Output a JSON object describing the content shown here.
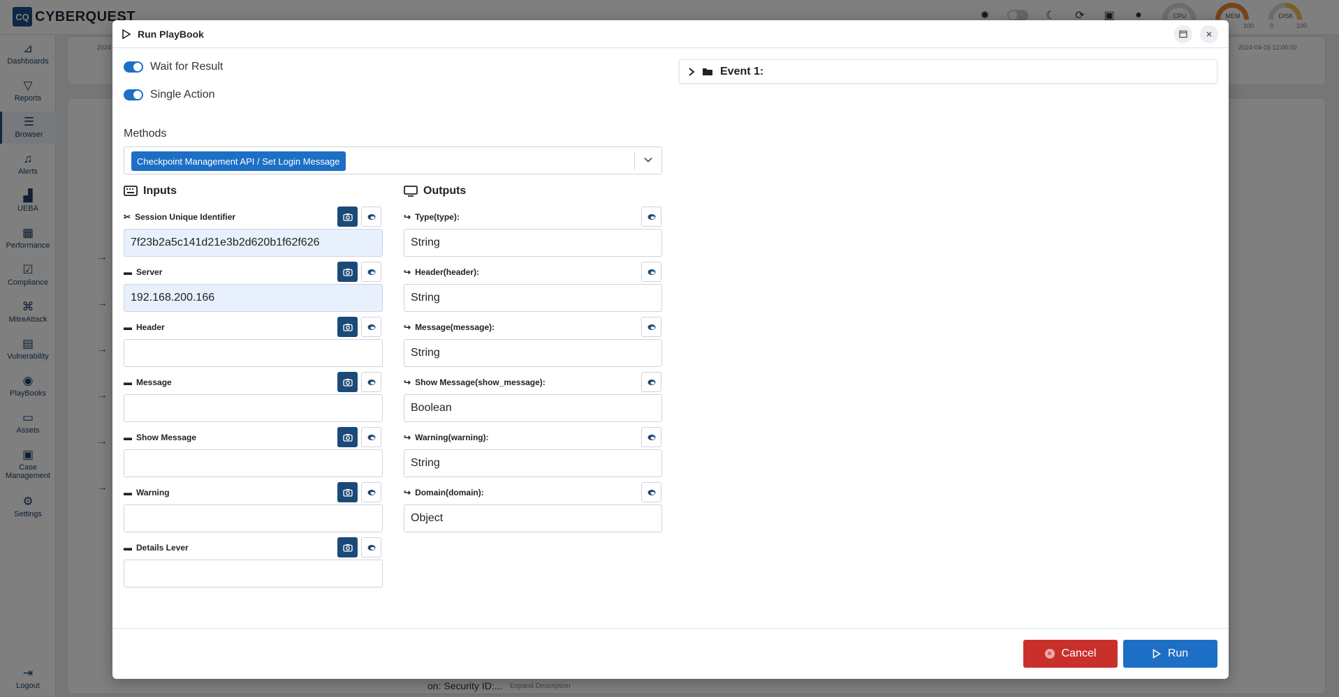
{
  "app": {
    "logo_badge": "CQ",
    "logo_text": "CYBERQUEST",
    "gauges": [
      {
        "label": "CPU"
      },
      {
        "label": "MEM",
        "max": "100"
      },
      {
        "label": "DISK",
        "min": "0",
        "max": "100"
      }
    ],
    "sidebar": [
      {
        "label": "Dashboards",
        "icon": "dashboards-icon"
      },
      {
        "label": "Reports",
        "icon": "filter-icon"
      },
      {
        "label": "Browser",
        "icon": "list-icon"
      },
      {
        "label": "Alerts",
        "icon": "bell-icon"
      },
      {
        "label": "UEBA",
        "icon": "chart-icon"
      },
      {
        "label": "Performance",
        "icon": "keyboard-icon"
      },
      {
        "label": "Compliance",
        "icon": "compliance-icon"
      },
      {
        "label": "MitreAttack",
        "icon": "command-icon"
      },
      {
        "label": "Vulnerability",
        "icon": "server-icon"
      },
      {
        "label": "PlayBooks",
        "icon": "playbooks-icon"
      },
      {
        "label": "Assets",
        "icon": "laptop-icon"
      },
      {
        "label": "Case Management",
        "icon": "briefcase-icon"
      },
      {
        "label": "Settings",
        "icon": "gear-icon"
      },
      {
        "label": "Logout",
        "icon": "logout-icon"
      }
    ],
    "bg_timestamp": "2024-04-16 12:00:00",
    "bg_date_prefix": "2024",
    "bg_row_text": "on: Security ID:...",
    "bg_expand_label": "Expand Description"
  },
  "modal": {
    "title": "Run PlayBook",
    "wait_for_result": "Wait for Result",
    "single_action": "Single Action",
    "methods_label": "Methods",
    "method_selected": "Checkpoint Management API / Set Login Message",
    "inputs_title": "Inputs",
    "outputs_title": "Outputs",
    "inputs": [
      {
        "label": "Session Unique Identifier",
        "value": "7f23b2a5c141d21e3b2d620b1f62f626"
      },
      {
        "label": "Server",
        "value": "192.168.200.166"
      },
      {
        "label": "Header",
        "value": ""
      },
      {
        "label": "Message",
        "value": ""
      },
      {
        "label": "Show Message",
        "value": ""
      },
      {
        "label": "Warning",
        "value": ""
      },
      {
        "label": "Details Lever",
        "value": ""
      }
    ],
    "outputs": [
      {
        "label": "Type(type):",
        "value": "String"
      },
      {
        "label": "Header(header):",
        "value": "String"
      },
      {
        "label": "Message(message):",
        "value": "String"
      },
      {
        "label": "Show Message(show_message):",
        "value": "Boolean"
      },
      {
        "label": "Warning(warning):",
        "value": "String"
      },
      {
        "label": "Domain(domain):",
        "value": "Object"
      }
    ],
    "event_title": "Event 1:",
    "cancel_label": "Cancel",
    "run_label": "Run"
  },
  "colors": {
    "primary": "#1d6fc5",
    "dark_button": "#1c4a78",
    "danger": "#c9302c"
  }
}
